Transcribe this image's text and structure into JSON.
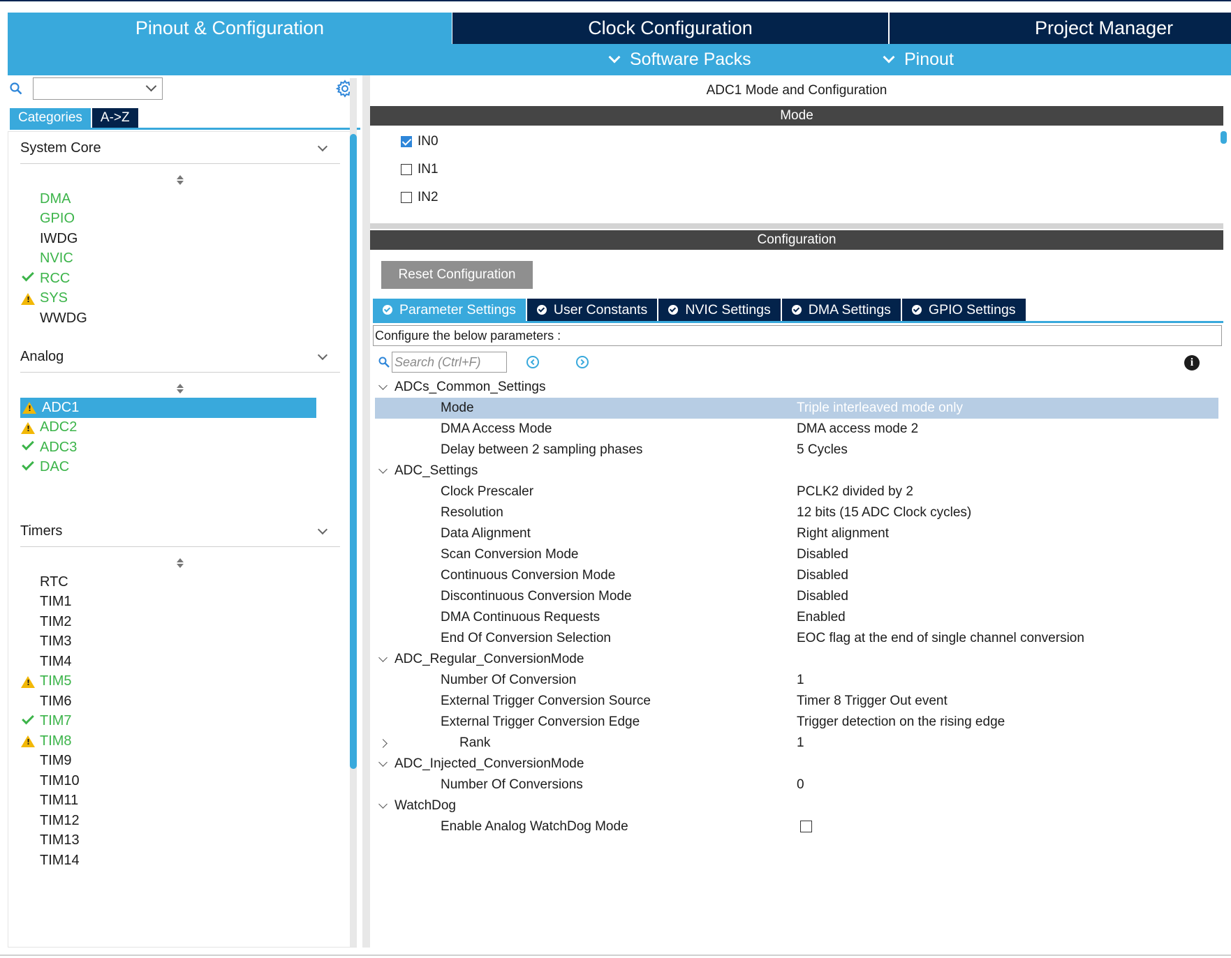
{
  "nav": {
    "tabs": [
      {
        "label": "Pinout & Configuration"
      },
      {
        "label": "Clock Configuration"
      },
      {
        "label": "Project Manager"
      }
    ],
    "sub": [
      {
        "label": "Software Packs"
      },
      {
        "label": "Pinout"
      }
    ]
  },
  "left": {
    "search_value": "",
    "tabs": [
      "Categories",
      "A->Z"
    ],
    "sections": [
      {
        "title": "System Core",
        "items": [
          {
            "label": "DMA",
            "status": "green"
          },
          {
            "label": "GPIO",
            "status": "green"
          },
          {
            "label": "IWDG",
            "status": "plain"
          },
          {
            "label": "NVIC",
            "status": "green"
          },
          {
            "label": "RCC",
            "status": "ok"
          },
          {
            "label": "SYS",
            "status": "warn"
          },
          {
            "label": "WWDG",
            "status": "plain"
          }
        ]
      },
      {
        "title": "Analog",
        "items": [
          {
            "label": "ADC1",
            "status": "warn-selected"
          },
          {
            "label": "ADC2",
            "status": "warn"
          },
          {
            "label": "ADC3",
            "status": "ok"
          },
          {
            "label": "DAC",
            "status": "ok"
          }
        ]
      },
      {
        "title": "Timers",
        "items": [
          {
            "label": "RTC",
            "status": "plain"
          },
          {
            "label": "TIM1",
            "status": "plain"
          },
          {
            "label": "TIM2",
            "status": "plain"
          },
          {
            "label": "TIM3",
            "status": "plain"
          },
          {
            "label": "TIM4",
            "status": "plain"
          },
          {
            "label": "TIM5",
            "status": "warn"
          },
          {
            "label": "TIM6",
            "status": "plain"
          },
          {
            "label": "TIM7",
            "status": "ok"
          },
          {
            "label": "TIM8",
            "status": "warn"
          },
          {
            "label": "TIM9",
            "status": "plain"
          },
          {
            "label": "TIM10",
            "status": "plain"
          },
          {
            "label": "TIM11",
            "status": "plain"
          },
          {
            "label": "TIM12",
            "status": "plain"
          },
          {
            "label": "TIM13",
            "status": "plain"
          },
          {
            "label": "TIM14",
            "status": "plain"
          }
        ]
      }
    ]
  },
  "right": {
    "title": "ADC1 Mode and Configuration",
    "mode_header": "Mode",
    "mode_inputs": [
      {
        "label": "IN0",
        "checked": true
      },
      {
        "label": "IN1",
        "checked": false
      },
      {
        "label": "IN2",
        "checked": false
      }
    ],
    "config_header": "Configuration",
    "reset_label": "Reset Configuration",
    "tabs": [
      {
        "label": "Parameter Settings"
      },
      {
        "label": "User Constants"
      },
      {
        "label": "NVIC Settings"
      },
      {
        "label": "DMA Settings"
      },
      {
        "label": "GPIO Settings"
      }
    ],
    "description": "Configure the below parameters :",
    "search_placeholder": "Search (Ctrl+F)",
    "params": [
      {
        "kind": "group",
        "name": "ADCs_Common_Settings"
      },
      {
        "kind": "param",
        "name": "Mode",
        "value": "Triple interleaved mode only",
        "selected": true
      },
      {
        "kind": "param",
        "name": "DMA Access Mode",
        "value": "DMA access mode 2"
      },
      {
        "kind": "param",
        "name": "Delay between 2 sampling phases",
        "value": "5 Cycles"
      },
      {
        "kind": "group",
        "name": "ADC_Settings"
      },
      {
        "kind": "param",
        "name": "Clock Prescaler",
        "value": "PCLK2 divided by 2"
      },
      {
        "kind": "param",
        "name": "Resolution",
        "value": "12 bits (15 ADC Clock cycles)"
      },
      {
        "kind": "param",
        "name": "Data Alignment",
        "value": "Right alignment"
      },
      {
        "kind": "param",
        "name": "Scan Conversion Mode",
        "value": "Disabled"
      },
      {
        "kind": "param",
        "name": "Continuous Conversion Mode",
        "value": "Disabled"
      },
      {
        "kind": "param",
        "name": "Discontinuous Conversion Mode",
        "value": "Disabled"
      },
      {
        "kind": "param",
        "name": "DMA Continuous Requests",
        "value": "Enabled"
      },
      {
        "kind": "param",
        "name": "End Of Conversion Selection",
        "value": "EOC flag at the end of single channel conversion"
      },
      {
        "kind": "group",
        "name": "ADC_Regular_ConversionMode"
      },
      {
        "kind": "param",
        "name": "Number Of Conversion",
        "value": "1"
      },
      {
        "kind": "param",
        "name": "External Trigger Conversion Source",
        "value": "Timer 8 Trigger Out event"
      },
      {
        "kind": "param",
        "name": "External Trigger Conversion Edge",
        "value": "Trigger detection on the rising edge"
      },
      {
        "kind": "subgroup",
        "name": "Rank",
        "value": "1"
      },
      {
        "kind": "group",
        "name": "ADC_Injected_ConversionMode"
      },
      {
        "kind": "param",
        "name": "Number Of Conversions",
        "value": "0"
      },
      {
        "kind": "group",
        "name": "WatchDog"
      },
      {
        "kind": "checkbox",
        "name": "Enable Analog WatchDog Mode",
        "checked": false
      }
    ]
  },
  "colors": {
    "accent": "#39a9dc",
    "navy": "#03234b",
    "ok_green": "#3cb44a",
    "warn_yellow": "#f2b807"
  }
}
